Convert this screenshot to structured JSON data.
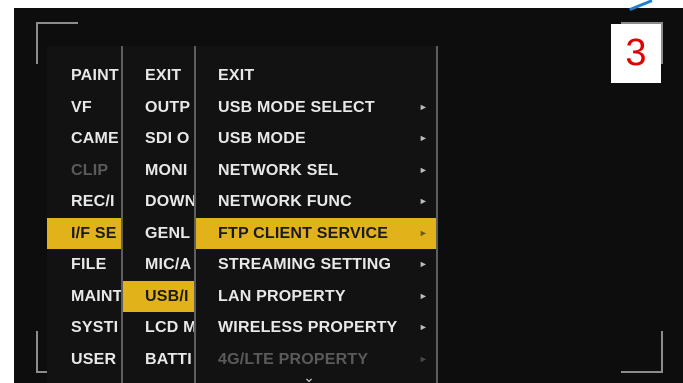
{
  "step_badge": "3",
  "colors": {
    "selected_bg": "#e1b219",
    "menu_bg": "#121212",
    "badge_text": "#e00000"
  },
  "menu": {
    "col1": [
      {
        "label": "PAINT",
        "state": "normal"
      },
      {
        "label": "VF",
        "state": "normal"
      },
      {
        "label": "CAME",
        "state": "normal"
      },
      {
        "label": "CLIP",
        "state": "disabled"
      },
      {
        "label": "REC/I",
        "state": "normal"
      },
      {
        "label": "I/F SE",
        "state": "selected"
      },
      {
        "label": "FILE",
        "state": "normal"
      },
      {
        "label": "MAINT",
        "state": "normal"
      },
      {
        "label": "SYSTI",
        "state": "normal"
      },
      {
        "label": "USER",
        "state": "normal"
      }
    ],
    "col2": [
      {
        "label": "EXIT",
        "state": "normal"
      },
      {
        "label": "OUTP",
        "state": "normal"
      },
      {
        "label": "SDI O",
        "state": "normal"
      },
      {
        "label": "MONI",
        "state": "normal"
      },
      {
        "label": "DOWN",
        "state": "normal"
      },
      {
        "label": "GENL",
        "state": "normal"
      },
      {
        "label": "MIC/A",
        "state": "normal"
      },
      {
        "label": "USB/I",
        "state": "selected"
      },
      {
        "label": "LCD M",
        "state": "normal"
      },
      {
        "label": "BATTI",
        "state": "normal"
      }
    ],
    "col3": [
      {
        "label": "EXIT",
        "state": "normal",
        "arrow": ""
      },
      {
        "label": "USB MODE SELECT",
        "state": "normal",
        "arrow": "►"
      },
      {
        "label": "USB MODE",
        "state": "normal",
        "arrow": "►"
      },
      {
        "label": "NETWORK SEL",
        "state": "normal",
        "arrow": "►"
      },
      {
        "label": "NETWORK FUNC",
        "state": "normal",
        "arrow": "►"
      },
      {
        "label": "FTP CLIENT SERVICE",
        "state": "selected",
        "arrow": "►"
      },
      {
        "label": "STREAMING SETTING",
        "state": "normal",
        "arrow": "►"
      },
      {
        "label": "LAN PROPERTY",
        "state": "normal",
        "arrow": "►"
      },
      {
        "label": "WIRELESS PROPERTY",
        "state": "normal",
        "arrow": "►"
      },
      {
        "label": "4G/LTE PROPERTY",
        "state": "disabled",
        "arrow": "►"
      }
    ],
    "scroll_indicator": "⌄"
  }
}
